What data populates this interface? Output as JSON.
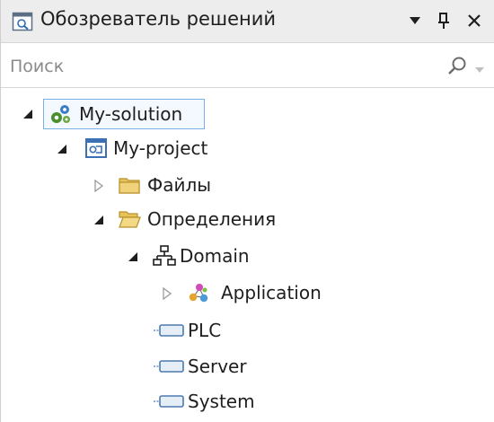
{
  "window": {
    "title": "Обозреватель решений",
    "menu_icon": "dropdown-triangle-icon",
    "pin_icon": "pin-icon",
    "close_icon": "close-icon"
  },
  "search": {
    "placeholder": "Поиск",
    "value": ""
  },
  "tree": {
    "solution": {
      "label": "My-solution",
      "icon": "solution-icon",
      "expanded": true
    },
    "project": {
      "label": "My-project",
      "icon": "project-icon",
      "expanded": true
    },
    "files": {
      "label": "Файлы",
      "icon": "folder-closed-icon",
      "expanded": false
    },
    "definitions": {
      "label": "Определения",
      "icon": "folder-open-icon",
      "expanded": true
    },
    "domain": {
      "label": "Domain",
      "icon": "network-hierarchy-icon",
      "expanded": true
    },
    "application": {
      "label": "Application",
      "icon": "application-nodes-icon",
      "expanded": false
    },
    "plc": {
      "label": "PLC",
      "icon": "device-icon"
    },
    "server": {
      "label": "Server",
      "icon": "device-icon"
    },
    "system": {
      "label": "System",
      "icon": "device-icon"
    }
  },
  "colors": {
    "selection_border": "#7ab0e4",
    "folder_yellow": "#e8c35a"
  }
}
